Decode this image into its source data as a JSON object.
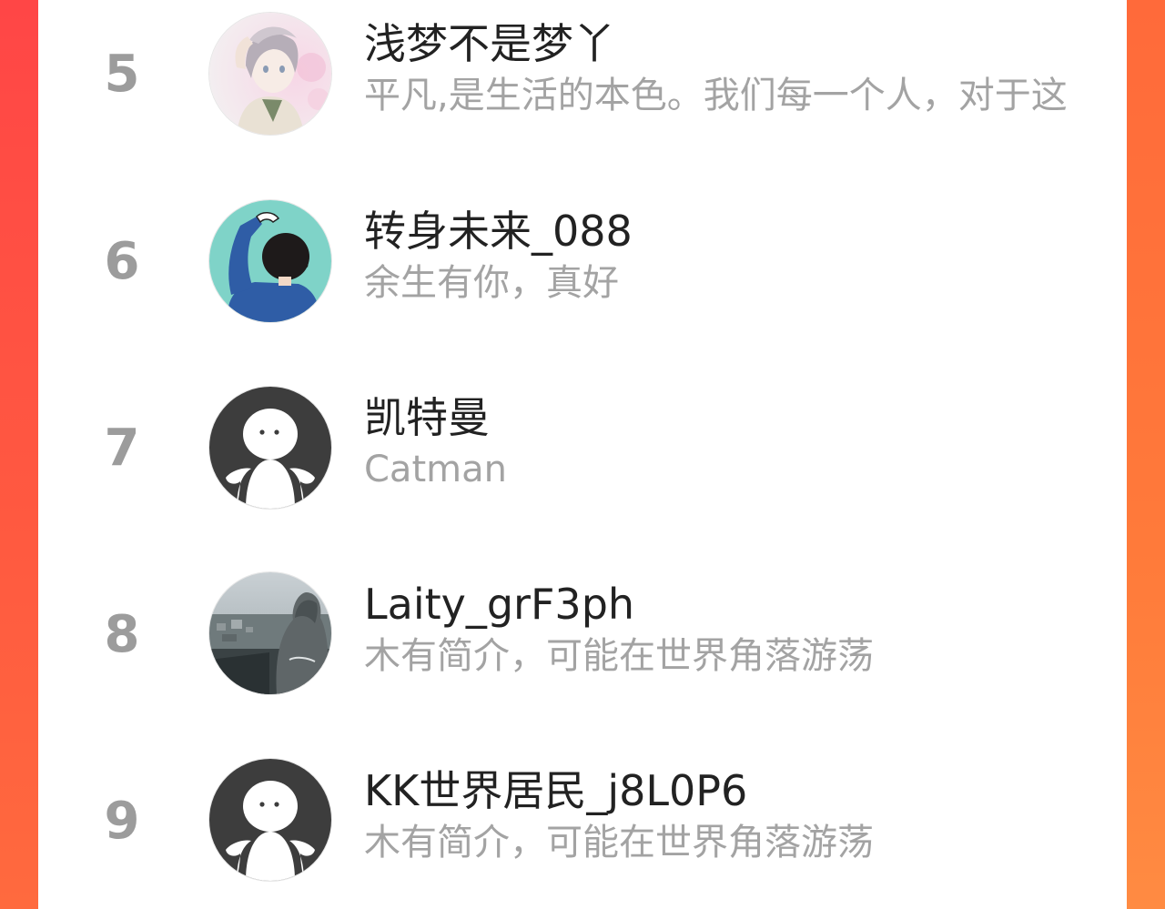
{
  "colors": {
    "rank": "#9c9c9c",
    "name": "#222222",
    "bio": "#a3a3a3",
    "accent_left": "#ff4646",
    "accent_right": "#ff7a3a"
  },
  "users": [
    {
      "rank": "5",
      "name": "浅梦不是梦丫",
      "bio": "平凡,是生活的本色。我们每一个人，对于这",
      "avatar": "anime-avatar-icon"
    },
    {
      "rank": "6",
      "name": "转身未来_088",
      "bio": "余生有你，真好",
      "avatar": "cartoon-boy-avatar-icon"
    },
    {
      "rank": "7",
      "name": "凯特曼",
      "bio": "Catman",
      "avatar": "default-avatar-icon"
    },
    {
      "rank": "8",
      "name": "Laity_grF3ph",
      "bio": "木有简介，可能在世界角落游荡",
      "avatar": "photo-avatar-icon"
    },
    {
      "rank": "9",
      "name": "KK世界居民_j8L0P6",
      "bio": "木有简介，可能在世界角落游荡",
      "avatar": "default-avatar-icon"
    }
  ]
}
